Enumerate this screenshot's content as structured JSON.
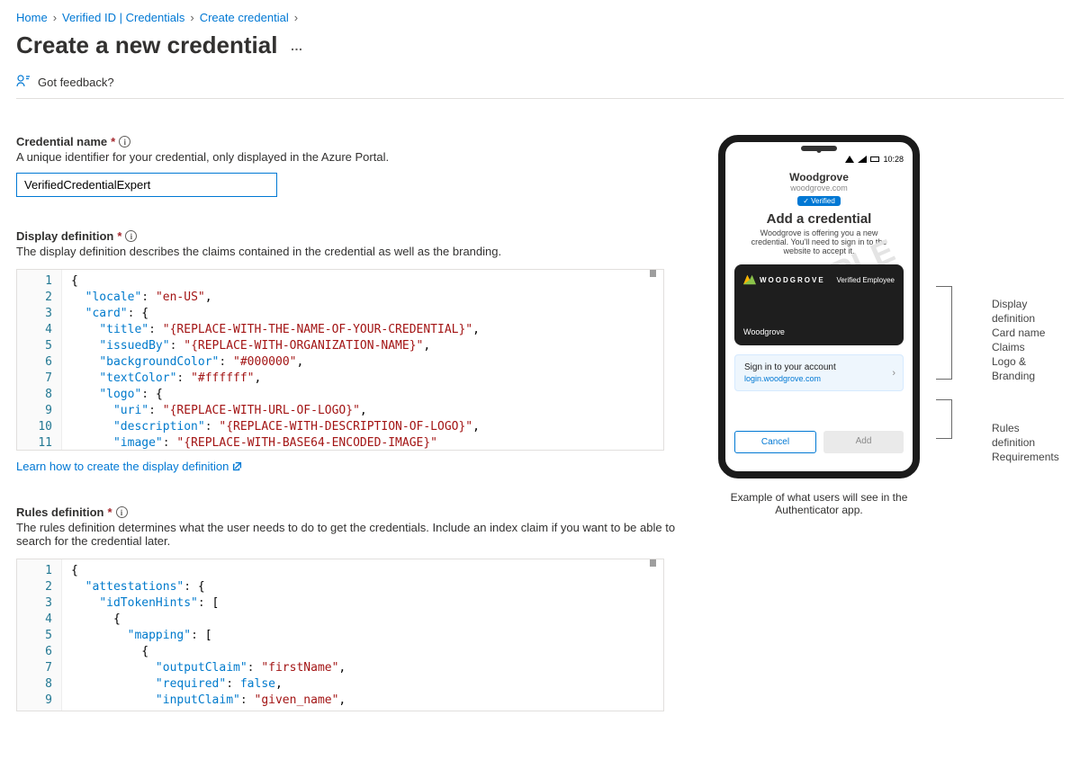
{
  "breadcrumb": {
    "home": "Home",
    "verified": "Verified ID | Credentials",
    "create": "Create credential"
  },
  "page_title": "Create a new credential",
  "more_label": "…",
  "feedback": "Got feedback?",
  "credential_name": {
    "label": "Credential name",
    "desc": "A unique identifier for your credential, only displayed in the Azure Portal.",
    "value": "VerifiedCredentialExpert"
  },
  "display_def": {
    "label": "Display definition",
    "desc": "The display definition describes the claims contained in the credential as well as the branding.",
    "link": "Learn how to create the display definition",
    "code_lines": [
      "{",
      "  \"locale\": \"en-US\",",
      "  \"card\": {",
      "    \"title\": \"{REPLACE-WITH-THE-NAME-OF-YOUR-CREDENTIAL}\",",
      "    \"issuedBy\": \"{REPLACE-WITH-ORGANIZATION-NAME}\",",
      "    \"backgroundColor\": \"#000000\",",
      "    \"textColor\": \"#ffffff\",",
      "    \"logo\": {",
      "      \"uri\": \"{REPLACE-WITH-URL-OF-LOGO}\",",
      "      \"description\": \"{REPLACE-WITH-DESCRIPTION-OF-LOGO}\",",
      "      \"image\": \"{REPLACE-WITH-BASE64-ENCODED-IMAGE}\""
    ]
  },
  "rules_def": {
    "label": "Rules definition",
    "desc": "The rules definition determines what the user needs to do to get the credentials. Include an index claim if you want to be able to search for the credential later.",
    "code_lines": [
      "{",
      "  \"attestations\": {",
      "    \"idTokenHints\": [",
      "      {",
      "        \"mapping\": [",
      "          {",
      "            \"outputClaim\": \"firstName\",",
      "            \"required\": false,",
      "            \"inputClaim\": \"given_name\","
    ]
  },
  "phone": {
    "time": "10:28",
    "org": "Woodgrove",
    "domain": "woodgrove.com",
    "verified": "✓ Verified",
    "title": "Add a credential",
    "subtitle1": "Woodgrove is offering you a new",
    "subtitle2": "credential. You'll need to sign in to the",
    "subtitle3": "website to accept it.",
    "watermark": "EXAMPLE",
    "card_brand": "WOODGROVE",
    "card_type": "Verified Employee",
    "card_issuer": "Woodgrove",
    "signin_title": "Sign in to your account",
    "signin_domain": "login.woodgrove.com",
    "btn_cancel": "Cancel",
    "btn_add": "Add"
  },
  "annot": {
    "dd_title": "Display",
    "dd_title2": "definition",
    "dd_l1": "Card name",
    "dd_l2": "Claims",
    "dd_l3": "Logo &",
    "dd_l4": "Branding",
    "rd_title": "Rules",
    "rd_title2": "definition",
    "rd_l1": "Requirements"
  },
  "caption": "Example of what users will see in the Authenticator app."
}
